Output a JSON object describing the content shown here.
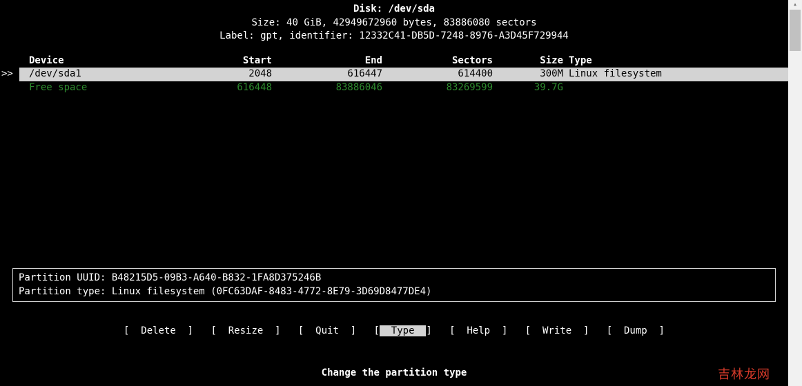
{
  "header": {
    "disk_label": "Disk: /dev/sda",
    "size_line": "Size: 40 GiB, 42949672960 bytes, 83886080 sectors",
    "label_line": "Label: gpt, identifier: 12332C41-DB5D-7248-8976-A3D45F729944"
  },
  "columns": {
    "device": "Device",
    "start": "Start",
    "end": "End",
    "sectors": "Sectors",
    "size": "Size",
    "type": "Type"
  },
  "rows": [
    {
      "cursor": ">>",
      "device": "/dev/sda1",
      "start": "2048",
      "end": "616447",
      "sectors": "614400",
      "size": "300M",
      "type": "Linux filesystem",
      "selected": true,
      "free": false
    },
    {
      "cursor": "",
      "device": "Free space",
      "start": "616448",
      "end": "83886046",
      "sectors": "83269599",
      "size": "39.7G",
      "type": "",
      "selected": false,
      "free": true
    }
  ],
  "info": {
    "uuid_line": "Partition UUID: B48215D5-09B3-A640-B832-1FA8D375246B",
    "type_line": "Partition type: Linux filesystem (0FC63DAF-8483-4772-8E79-3D69D8477DE4)"
  },
  "menu": {
    "items": [
      {
        "label": "Delete",
        "selected": false
      },
      {
        "label": "Resize",
        "selected": false
      },
      {
        "label": "Quit",
        "selected": false
      },
      {
        "label": "Type",
        "selected": true
      },
      {
        "label": "Help",
        "selected": false
      },
      {
        "label": "Write",
        "selected": false
      },
      {
        "label": "Dump",
        "selected": false
      }
    ]
  },
  "hint": "Change the partition type",
  "watermark": "吉林龙网"
}
